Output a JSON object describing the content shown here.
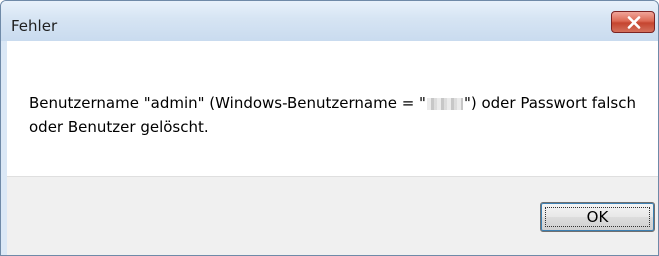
{
  "window": {
    "title": "Fehler"
  },
  "message": {
    "part1": "Benutzername \"admin\" (Windows-Benutzername = \"",
    "part2": "\") oder Passwort falsch oder Benutzer gelöscht."
  },
  "buttons": {
    "ok_label": "OK"
  },
  "icons": {
    "close": "close-icon"
  },
  "colors": {
    "close_button": "#c5452f",
    "titlebar": "#d6e4f3"
  }
}
